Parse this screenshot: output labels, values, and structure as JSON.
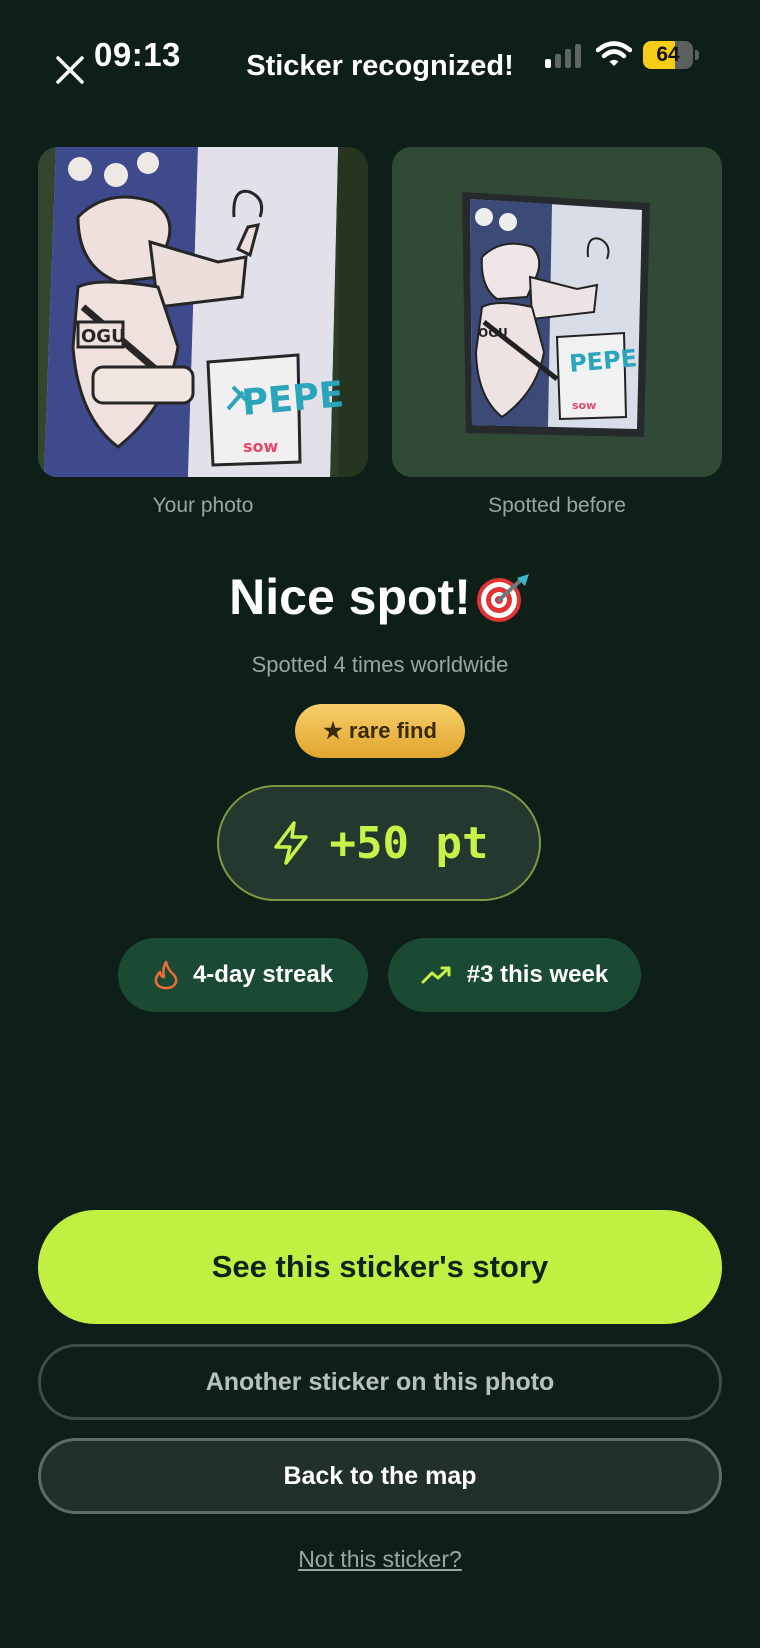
{
  "status_bar": {
    "time": "09:13",
    "battery": "64",
    "battery_level": 0.64,
    "signal_icon": "cellular-signal-icon",
    "wifi_icon": "wifi-icon"
  },
  "header": {
    "title": "Sticker recognized!",
    "close_icon": "close-icon"
  },
  "photos": {
    "yours_caption": "Your photo",
    "previous_caption": "Spotted before"
  },
  "result": {
    "headline": "Nice spot!",
    "headline_icon": "target-dart-icon",
    "subline": "Spotted 4 times worldwide",
    "rarity_badge": "★ rare find",
    "points": "+50 pt",
    "points_icon": "lightning-bolt-icon"
  },
  "stats": {
    "streak_label": "4-day streak",
    "streak_icon": "flame-icon",
    "rank_label": "#3 this week",
    "rank_icon": "trending-up-icon"
  },
  "actions": {
    "primary_label": "See this sticker's story",
    "another_label": "Another sticker on this photo",
    "map_label": "Back to the map",
    "wrong_link": "Not this sticker?"
  },
  "colors": {
    "background": "#0e1f19",
    "accent": "#c1f043",
    "points_text": "#c6f24a",
    "rare_badge": "#e9b84a",
    "chip_bg": "#1b4a34",
    "battery": "#f6cc17"
  }
}
